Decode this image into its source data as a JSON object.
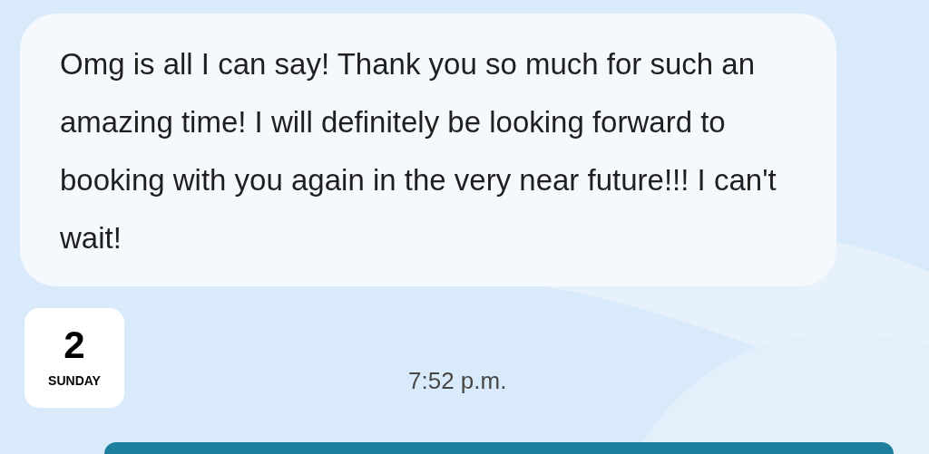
{
  "message": {
    "text": "Omg is all I can say! Thank you so much for such an amazing time! I will definitely be looking forward to booking with you again in the very near future!!! I can't wait!"
  },
  "date_badge": {
    "day": "2",
    "weekday": "SUNDAY"
  },
  "time": "7:52 p.m."
}
